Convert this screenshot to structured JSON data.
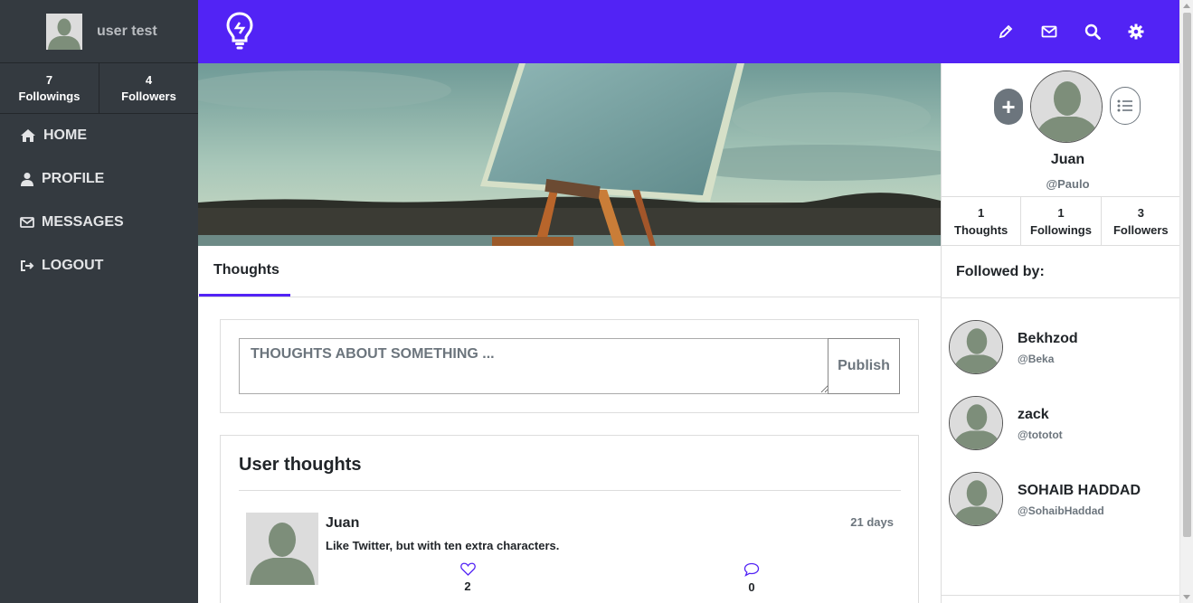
{
  "sidebar": {
    "user_name": "user test",
    "stats": [
      {
        "count": "7",
        "label": "Followings"
      },
      {
        "count": "4",
        "label": "Followers"
      }
    ],
    "nav": [
      {
        "label": "HOME",
        "icon": "home-icon"
      },
      {
        "label": "PROFILE",
        "icon": "user-icon"
      },
      {
        "label": "MESSAGES",
        "icon": "envelope-icon"
      },
      {
        "label": "LOGOUT",
        "icon": "logout-icon"
      }
    ]
  },
  "topbar": {
    "brand_color": "#5223f5",
    "logo_icon": "lightbulb-icon",
    "icons": [
      "pencil-icon",
      "envelope-icon",
      "search-icon",
      "gear-icon"
    ]
  },
  "tabs": {
    "active": "Thoughts"
  },
  "compose": {
    "placeholder": "Thoughts about something ...",
    "publish_label": "Publish"
  },
  "user_thoughts": {
    "title": "User thoughts",
    "posts": [
      {
        "author": "Juan",
        "time": "21 days",
        "text": "Like Twitter, but with ten extra characters.",
        "likes": "2",
        "comments": "0"
      }
    ]
  },
  "profile": {
    "name": "Juan",
    "handle": "@Paulo",
    "stats": [
      {
        "count": "1",
        "label": "Thoughts"
      },
      {
        "count": "1",
        "label": "Followings"
      },
      {
        "count": "3",
        "label": "Followers"
      }
    ],
    "followed_by_title": "Followed by:",
    "followers": [
      {
        "name": "Bekhzod",
        "handle": "@Beka"
      },
      {
        "name": "zack",
        "handle": "@tototot"
      },
      {
        "name": "SOHAIB HADDAD",
        "handle": "@SohaibHaddad"
      }
    ]
  }
}
